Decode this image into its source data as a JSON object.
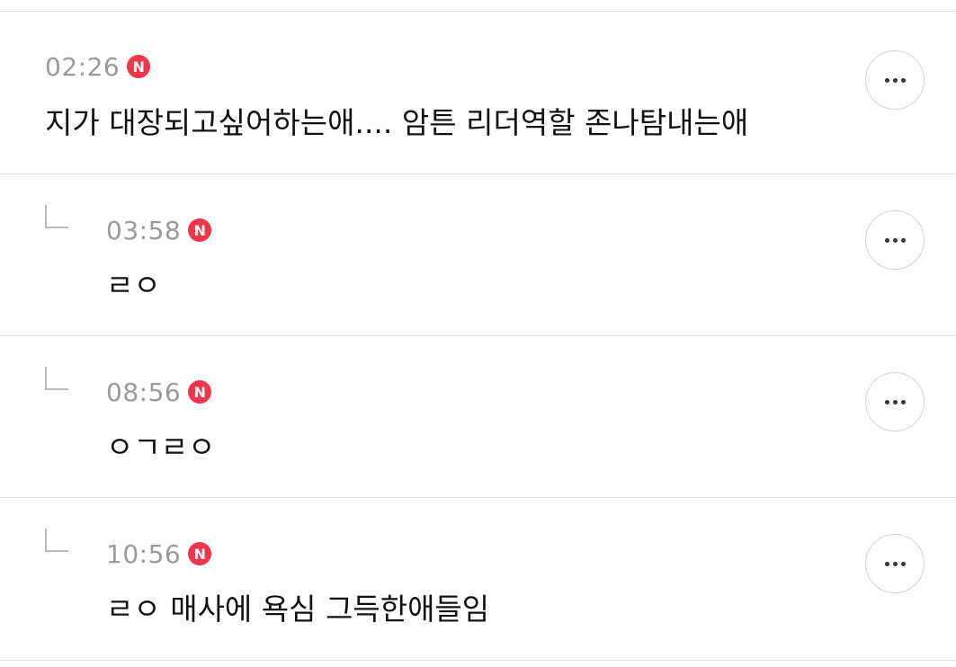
{
  "comments": [
    {
      "time": "02:26",
      "badge": "N",
      "text": "지가 대장되고싶어하는애....  암튼 리더역할 존나탐내는애",
      "is_reply": false
    },
    {
      "time": "03:58",
      "badge": "N",
      "text": "ㄹㅇ",
      "is_reply": true
    },
    {
      "time": "08:56",
      "badge": "N",
      "text": "ㅇㄱㄹㅇ",
      "is_reply": true
    },
    {
      "time": "10:56",
      "badge": "N",
      "text": "ㄹㅇ 매사에 욕심 그득한애들임",
      "is_reply": true
    }
  ],
  "icons": {
    "more": "more-horizontal-icon",
    "reply": "reply-arrow-icon",
    "new": "new-badge-icon"
  },
  "colors": {
    "badge": "#f0364a",
    "time": "#9a9a9a",
    "divider": "#e3e3e3",
    "text": "#111111"
  }
}
